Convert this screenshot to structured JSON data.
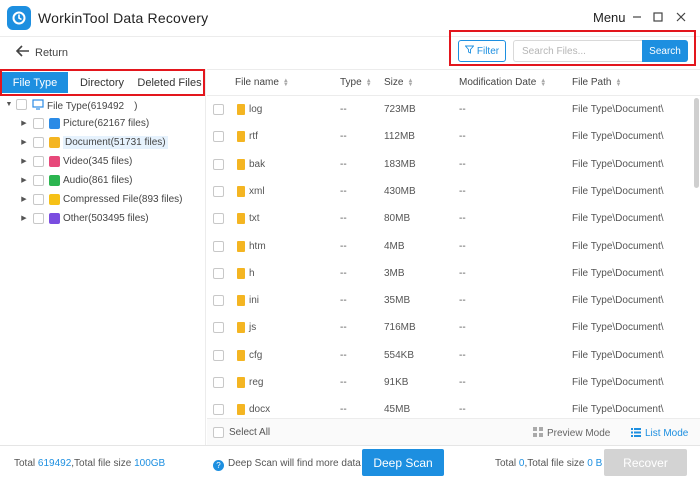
{
  "app": {
    "title": "WorkinTool Data Recovery",
    "menu_label": "Menu"
  },
  "toolbar": {
    "return_label": "Return",
    "filter_label": "Filter",
    "search_placeholder": "Search Files...",
    "search_value": "",
    "search_button": "Search"
  },
  "tabs": [
    {
      "label": "File Type",
      "active": true
    },
    {
      "label": "Directory",
      "active": false
    },
    {
      "label": "Deleted Files",
      "active": false
    }
  ],
  "tree": {
    "root": {
      "label": "File Type(619492　)"
    },
    "items": [
      {
        "label": "Picture(62167 files)",
        "icon": "picture-icon",
        "color": "#2b8be6"
      },
      {
        "label": "Document(51731 files)",
        "icon": "document-icon",
        "color": "#f4b522",
        "selected": true
      },
      {
        "label": "Video(345 files)",
        "icon": "video-icon",
        "color": "#e7487a"
      },
      {
        "label": "Audio(861 files)",
        "icon": "audio-icon",
        "color": "#2bb550"
      },
      {
        "label": "Compressed File(893 files)",
        "icon": "compressed-icon",
        "color": "#f6c117"
      },
      {
        "label": "Other(503495 files)",
        "icon": "other-icon",
        "color": "#7a4de0"
      }
    ]
  },
  "table": {
    "columns": [
      "File name",
      "Type",
      "Size",
      "Modification Date",
      "File Path"
    ],
    "rows": [
      {
        "name": "log",
        "type": "--",
        "size": "723MB",
        "date": "--",
        "path": "File Type\\Document\\"
      },
      {
        "name": "rtf",
        "type": "--",
        "size": "112MB",
        "date": "--",
        "path": "File Type\\Document\\"
      },
      {
        "name": "bak",
        "type": "--",
        "size": "183MB",
        "date": "--",
        "path": "File Type\\Document\\"
      },
      {
        "name": "xml",
        "type": "--",
        "size": "430MB",
        "date": "--",
        "path": "File Type\\Document\\"
      },
      {
        "name": "txt",
        "type": "--",
        "size": "80MB",
        "date": "--",
        "path": "File Type\\Document\\"
      },
      {
        "name": "htm",
        "type": "--",
        "size": "4MB",
        "date": "--",
        "path": "File Type\\Document\\"
      },
      {
        "name": "h",
        "type": "--",
        "size": "3MB",
        "date": "--",
        "path": "File Type\\Document\\"
      },
      {
        "name": "ini",
        "type": "--",
        "size": "35MB",
        "date": "--",
        "path": "File Type\\Document\\"
      },
      {
        "name": "js",
        "type": "--",
        "size": "716MB",
        "date": "--",
        "path": "File Type\\Document\\"
      },
      {
        "name": "cfg",
        "type": "--",
        "size": "554KB",
        "date": "--",
        "path": "File Type\\Document\\"
      },
      {
        "name": "reg",
        "type": "--",
        "size": "91KB",
        "date": "--",
        "path": "File Type\\Document\\"
      },
      {
        "name": "docx",
        "type": "--",
        "size": "45MB",
        "date": "--",
        "path": "File Type\\Document\\"
      }
    ]
  },
  "bottom_bar": {
    "select_all": "Select All",
    "preview_mode": "Preview Mode",
    "list_mode": "List Mode"
  },
  "footer": {
    "total_prefix": "Total ",
    "total_count": "619492",
    "total_size_prefix": ",Total file size ",
    "total_size": "100GB",
    "deep_scan_hint": "Deep Scan will find more data",
    "deep_scan_button": "Deep Scan",
    "selected_prefix": "Total ",
    "selected_count": "0",
    "selected_size_prefix": ",Total file size ",
    "selected_size": "0 B",
    "recover_button": "Recover"
  },
  "colors": {
    "accent": "#1d8fe0",
    "highlight_border": "#e3161d",
    "folder": "#f4b522",
    "disabled": "#d3d3d3"
  }
}
